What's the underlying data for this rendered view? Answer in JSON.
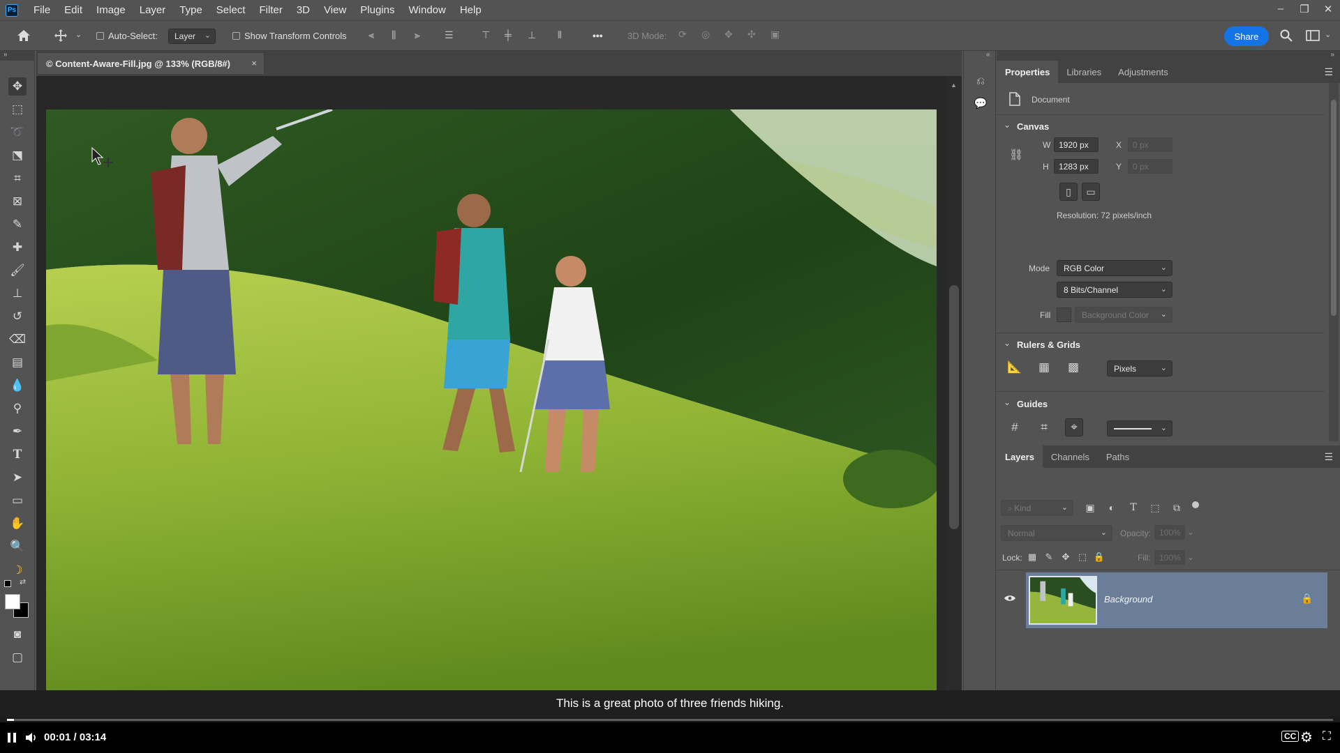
{
  "menubar": {
    "app_badge": "Ps",
    "items": [
      "File",
      "Edit",
      "Image",
      "Layer",
      "Type",
      "Select",
      "Filter",
      "3D",
      "View",
      "Plugins",
      "Window",
      "Help"
    ],
    "window_controls": [
      "minimize-icon",
      "restore-icon",
      "close-icon"
    ]
  },
  "options_bar": {
    "auto_select_label": "Auto-Select:",
    "auto_select_target": "Layer",
    "show_transform_label": "Show Transform Controls",
    "more_label": "•••",
    "mode_3d_label": "3D Mode:",
    "share_label": "Share"
  },
  "document": {
    "tab_title": "© Content-Aware-Fill.jpg @ 133% (RGB/8#)",
    "close_glyph": "×"
  },
  "properties_panel": {
    "tabs": [
      "Properties",
      "Libraries",
      "Adjustments"
    ],
    "active_tab": "Properties",
    "header_label": "Document",
    "canvas": {
      "title": "Canvas",
      "w_label": "W",
      "w_value": "1920 px",
      "h_label": "H",
      "h_value": "1283 px",
      "x_label": "X",
      "x_value": "0 px",
      "y_label": "Y",
      "y_value": "0 px",
      "resolution": "Resolution: 72 pixels/inch",
      "mode_label": "Mode",
      "mode_value": "RGB Color",
      "bits_value": "8 Bits/Channel",
      "fill_label": "Fill",
      "fill_value": "Background Color"
    },
    "rulers": {
      "title": "Rulers & Grids",
      "units_value": "Pixels"
    },
    "guides": {
      "title": "Guides"
    }
  },
  "layers_panel": {
    "tabs": [
      "Layers",
      "Channels",
      "Paths"
    ],
    "active_tab": "Layers",
    "filter_placeholder": "Kind",
    "blend_mode": "Normal",
    "opacity_label": "Opacity:",
    "opacity_value": "100%",
    "lock_label": "Lock:",
    "fill_label": "Fill:",
    "fill_value": "100%",
    "layers": [
      {
        "name": "Background",
        "visible": true,
        "locked": true
      }
    ]
  },
  "video": {
    "caption": "This is a great photo of three friends hiking.",
    "time": "00:01 / 03:14",
    "progress": 0.005
  },
  "colors": {
    "ui_bg": "#535353",
    "canvas_bg": "#282828",
    "accent": "#1473e6",
    "layer_selected": "#6b7e99"
  }
}
